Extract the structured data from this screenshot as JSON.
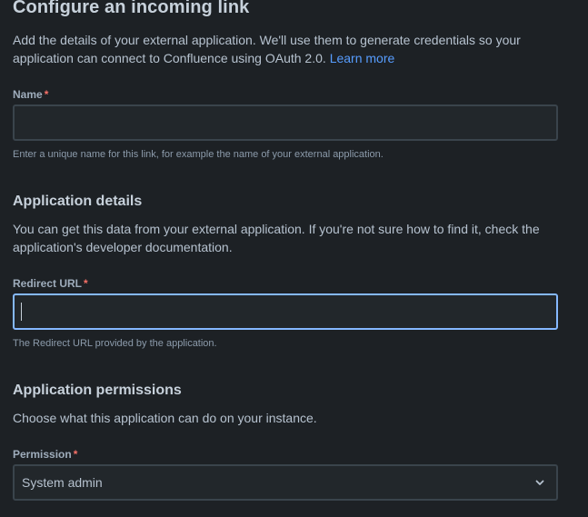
{
  "header": {
    "title": "Configure an incoming link",
    "description": "Add the details of your external application. We'll use them to generate credentials so your application can connect to Confluence using OAuth 2.0.",
    "learn_more": "Learn more"
  },
  "name_field": {
    "label": "Name",
    "required_mark": "*",
    "value": "",
    "helper": "Enter a unique name for this link, for example the name of your external application."
  },
  "application_details": {
    "title": "Application details",
    "description": "You can get this data from your external application. If you're not sure how to find it, check the application's developer documentation."
  },
  "redirect_url_field": {
    "label": "Redirect URL",
    "required_mark": "*",
    "value": "",
    "helper": "The Redirect URL provided by the application."
  },
  "application_permissions": {
    "title": "Application permissions",
    "description": "Choose what this application can do on your instance."
  },
  "permission_field": {
    "label": "Permission",
    "required_mark": "*",
    "selected": "System admin"
  },
  "icons": {
    "permission_dropdown": "chevron-down-icon"
  },
  "colors": {
    "background": "#1d2125",
    "link": "#579dff",
    "required": "#f87168",
    "focus_border": "#85b8ff",
    "field_border": "#3a444c"
  }
}
